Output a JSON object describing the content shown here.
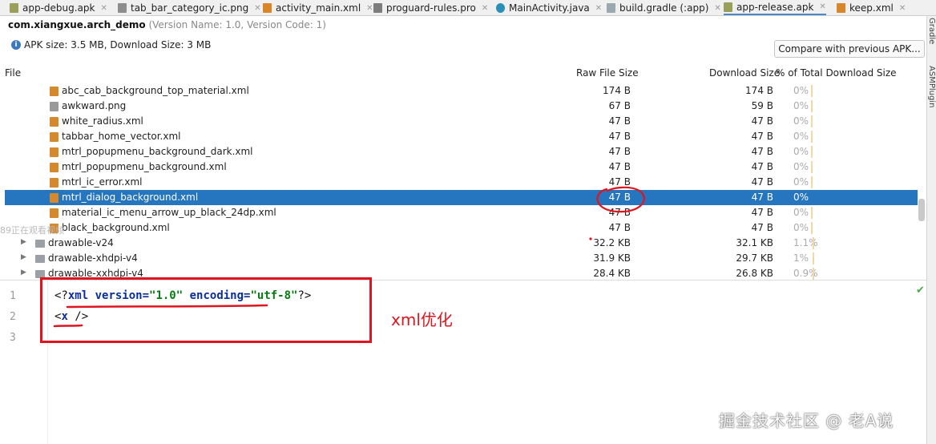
{
  "tabs": [
    {
      "label": "app-debug.apk",
      "icon": "apk-file-icon",
      "active": false
    },
    {
      "label": "tab_bar_category_ic.png",
      "icon": "image-file-icon",
      "active": false
    },
    {
      "label": "activity_main.xml",
      "icon": "xml-file-icon",
      "active": false
    },
    {
      "label": "proguard-rules.pro",
      "icon": "text-file-icon",
      "active": false
    },
    {
      "label": "MainActivity.java",
      "icon": "java-class-icon",
      "active": false
    },
    {
      "label": "build.gradle (:app)",
      "icon": "gradle-file-icon",
      "active": false
    },
    {
      "label": "app-release.apk",
      "icon": "apk-file-icon",
      "active": true
    },
    {
      "label": "keep.xml",
      "icon": "xml-file-icon",
      "active": false
    }
  ],
  "side_panels": [
    "Gradle",
    "ASMPlugin"
  ],
  "header": {
    "package": "com.xiangxue.arch_demo",
    "version": "(Version Name: 1.0, Version Code: 1)",
    "apk_size": "APK size: 3.5 MB, Download Size: 3 MB",
    "compare_button": "Compare with previous APK..."
  },
  "columns": {
    "file": "File",
    "raw": "Raw File Size",
    "download": "Download Size",
    "percent": "% of Total Download Size"
  },
  "rows": [
    {
      "name": "abc_cab_background_top_material.xml",
      "raw": "174 B",
      "download": "174 B",
      "percent": "0%",
      "kind": "xml"
    },
    {
      "name": "awkward.png",
      "raw": "67 B",
      "download": "59 B",
      "percent": "0%",
      "kind": "png"
    },
    {
      "name": "white_radius.xml",
      "raw": "47 B",
      "download": "47 B",
      "percent": "0%",
      "kind": "xml"
    },
    {
      "name": "tabbar_home_vector.xml",
      "raw": "47 B",
      "download": "47 B",
      "percent": "0%",
      "kind": "xml"
    },
    {
      "name": "mtrl_popupmenu_background_dark.xml",
      "raw": "47 B",
      "download": "47 B",
      "percent": "0%",
      "kind": "xml"
    },
    {
      "name": "mtrl_popupmenu_background.xml",
      "raw": "47 B",
      "download": "47 B",
      "percent": "0%",
      "kind": "xml"
    },
    {
      "name": "mtrl_ic_error.xml",
      "raw": "47 B",
      "download": "47 B",
      "percent": "0%",
      "kind": "xml"
    },
    {
      "name": "mtrl_dialog_background.xml",
      "raw": "47 B",
      "download": "47 B",
      "percent": "0%",
      "kind": "xml",
      "selected": true
    },
    {
      "name": "material_ic_menu_arrow_up_black_24dp.xml",
      "raw": "47 B",
      "download": "47 B",
      "percent": "0%",
      "kind": "xml"
    },
    {
      "name": "black_background.xml",
      "raw": "47 B",
      "download": "47 B",
      "percent": "0%",
      "kind": "xml"
    },
    {
      "name": "drawable-v24",
      "raw": "32.2 KB",
      "download": "32.1 KB",
      "percent": "1.1%",
      "kind": "folder"
    },
    {
      "name": "drawable-xhdpi-v4",
      "raw": "31.9 KB",
      "download": "29.7 KB",
      "percent": "1%",
      "kind": "folder"
    },
    {
      "name": "drawable-xxhdpi-v4",
      "raw": "28.4 KB",
      "download": "26.8 KB",
      "percent": "0.9%",
      "kind": "folder"
    }
  ],
  "editor": {
    "line_numbers": [
      "1",
      "2",
      "3"
    ],
    "line1": {
      "open": "<?",
      "xml": "xml",
      "version_attr": " version=",
      "version_val": "\"1.0\"",
      "encoding_attr": " encoding=",
      "encoding_val": "\"utf-8\"",
      "close": "?>"
    },
    "line2": {
      "open": "<",
      "tag": "x",
      "close": " />"
    }
  },
  "annotation": "xml优化",
  "watermark": "掘金技术社区 @ 老A说",
  "ghost_text": "89正在观看视频",
  "colors": {
    "selection": "#2675bf",
    "annotation": "#e0141e",
    "tab_active": "#4a88c7"
  }
}
